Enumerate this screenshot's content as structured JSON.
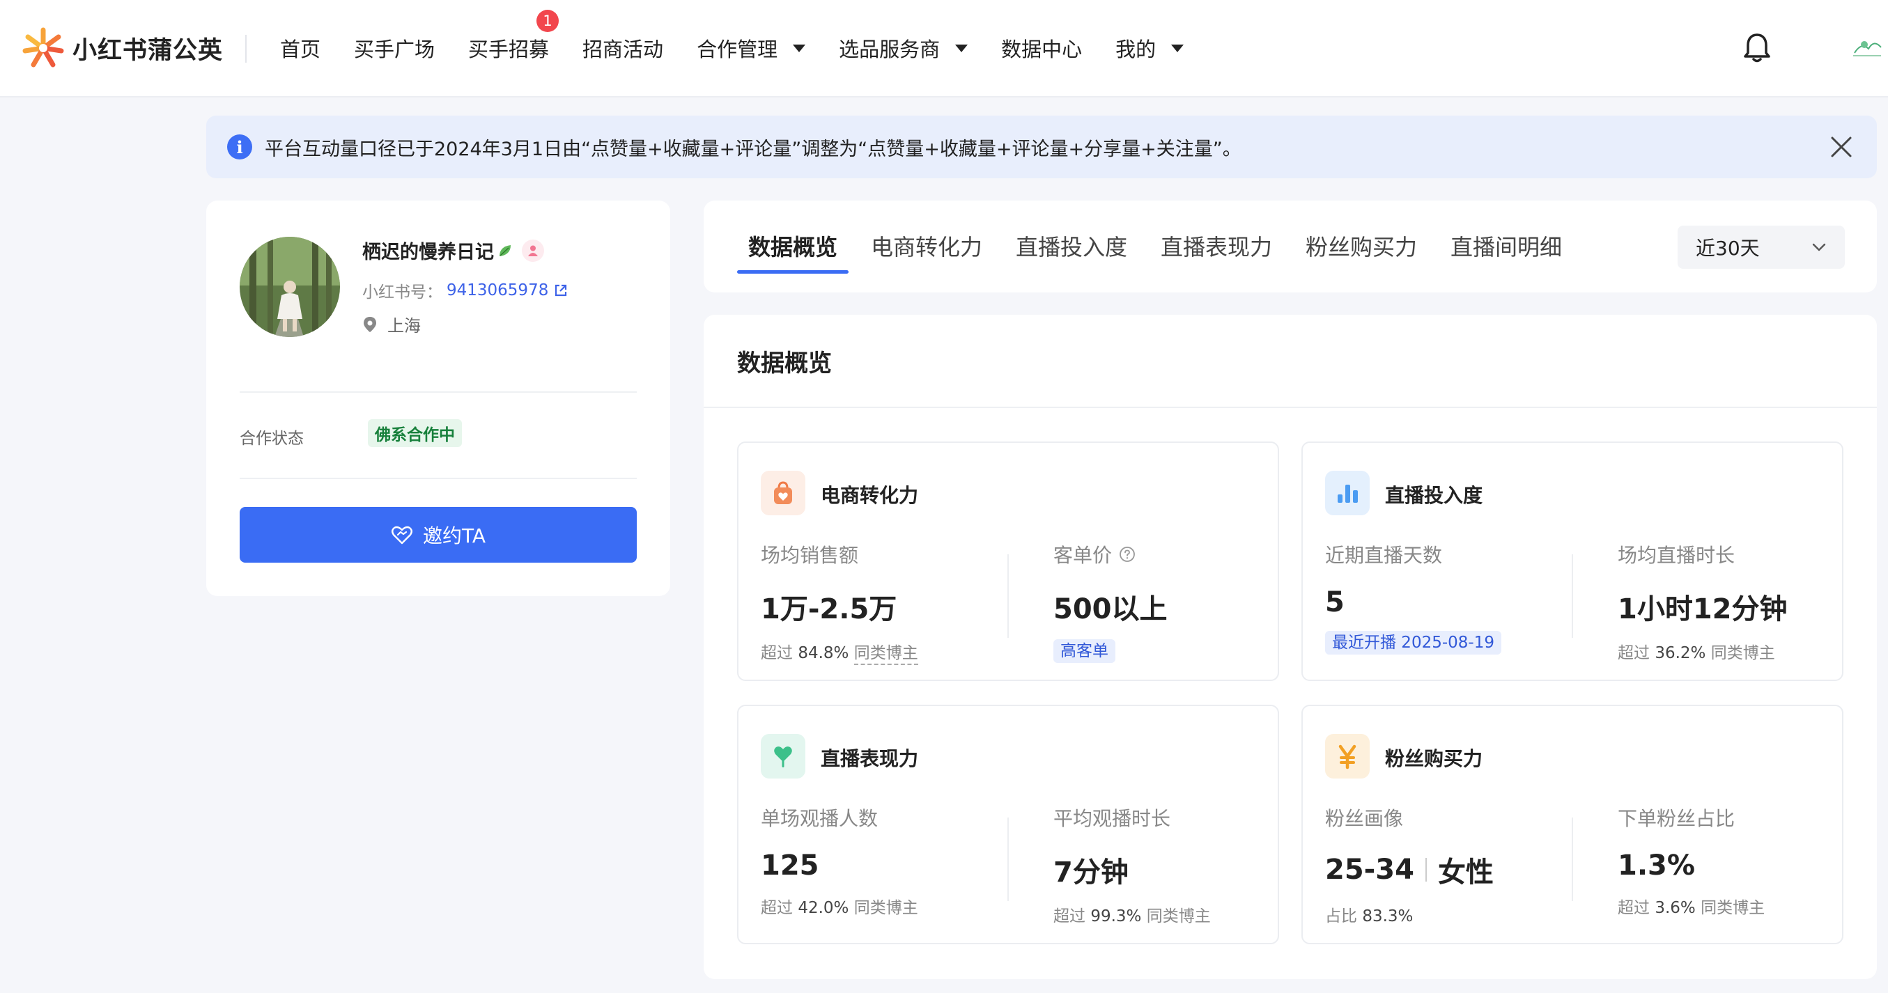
{
  "app": {
    "logo_text": "小红书蒲公英"
  },
  "nav": {
    "items": [
      {
        "label": "首页",
        "has_caret": false
      },
      {
        "label": "买手广场",
        "has_caret": false
      },
      {
        "label": "买手招募",
        "has_caret": false,
        "badge": "1"
      },
      {
        "label": "招商活动",
        "has_caret": false
      },
      {
        "label": "合作管理",
        "has_caret": true
      },
      {
        "label": "选品服务商",
        "has_caret": true
      },
      {
        "label": "数据中心",
        "has_caret": false
      },
      {
        "label": "我的",
        "has_caret": true
      }
    ]
  },
  "notice": {
    "text": "平台互动量口径已于2024年3月1日由“点赞量+收藏量+评论量”调整为“点赞量+收藏量+评论量+分享量+关注量”。"
  },
  "profile": {
    "name": "栖迟的慢养日记",
    "id_label": "小红书号：",
    "id_value": "9413065978",
    "location": "上海",
    "coop_label": "合作状态",
    "coop_status": "佛系合作中",
    "invite_label": "邀约TA"
  },
  "tabs": {
    "items": [
      "数据概览",
      "电商转化力",
      "直播投入度",
      "直播表现力",
      "粉丝购买力",
      "直播间明细"
    ],
    "active": "数据概览",
    "period": "近30天"
  },
  "overview": {
    "title": "数据概览",
    "cards": [
      {
        "title": "电商转化力",
        "left": {
          "label": "场均销售额",
          "value": "1万-2.5万",
          "note_prefix": "超过",
          "note_value": "84.8%",
          "note_suffix": "同类博主"
        },
        "right": {
          "label": "客单价",
          "value": "500以上",
          "tag": "高客单"
        }
      },
      {
        "title": "直播投入度",
        "left": {
          "label": "近期直播天数",
          "value": "5",
          "tag": "最近开播 2025-08-19"
        },
        "right": {
          "label": "场均直播时长",
          "value": "1小时12分钟",
          "note_prefix": "超过",
          "note_value": "36.2%",
          "note_suffix": "同类博主"
        }
      },
      {
        "title": "直播表现力",
        "left": {
          "label": "单场观播人数",
          "value": "125",
          "note_prefix": "超过",
          "note_value": "42.0%",
          "note_suffix": "同类博主"
        },
        "right": {
          "label": "平均观播时长",
          "value": "7分钟",
          "note_prefix": "超过",
          "note_value": "99.3%",
          "note_suffix": "同类博主"
        }
      },
      {
        "title": "粉丝购买力",
        "left": {
          "label": "粉丝画像",
          "value_a": "25-34",
          "value_b": "女性",
          "note_prefix": "占比",
          "note_value": "83.3%"
        },
        "right": {
          "label": "下单粉丝占比",
          "value": "1.3%",
          "note_prefix": "超过",
          "note_value": "3.6%",
          "note_suffix": "同类博主"
        }
      }
    ]
  },
  "colors": {
    "accent": "#3a6cf4",
    "notice_bg": "#e8eefc",
    "coop_green": "#17803b",
    "badge_red": "#f2464d"
  }
}
